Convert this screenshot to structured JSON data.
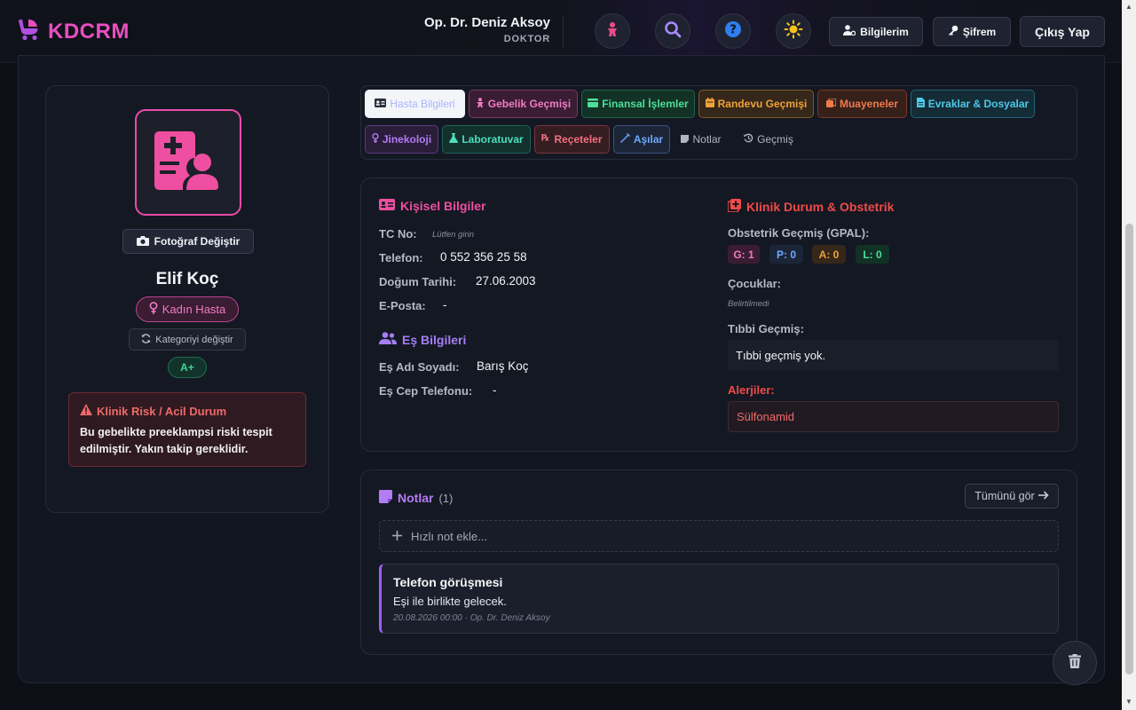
{
  "header": {
    "brand": "KDCRM",
    "user_name": "Op. Dr. Deniz Aksoy",
    "user_role": "DOKTOR",
    "btn_info": "Bilgilerim",
    "btn_password": "Şifrem",
    "btn_logout": "Çıkış Yap"
  },
  "profile": {
    "photo_btn": "Fotoğraf Değiştir",
    "name": "Elif Koç",
    "category": "Kadın Hasta",
    "change_category": "Kategoriyi değiştir",
    "blood_type": "A+",
    "risk_title": "Klinik Risk / Acil Durum",
    "risk_text": "Bu gebelikte preeklampsi riski tespit edilmiştir. Yakın takip gereklidir."
  },
  "tabs": [
    {
      "label": "Hasta Bilgileri",
      "icon": "id-card-icon",
      "color": "#a9b4ff"
    },
    {
      "label": "Gebelik Geçmişi",
      "icon": "baby-icon",
      "color": "#ef7cc2"
    },
    {
      "label": "Finansal İşlemler",
      "icon": "wallet-icon",
      "color": "#4ede9a"
    },
    {
      "label": "Randevu Geçmişi",
      "icon": "calendar-icon",
      "color": "#f0a23a"
    },
    {
      "label": "Muayeneler",
      "icon": "stethoscope-icon",
      "color": "#f07a4a"
    },
    {
      "label": "Evraklar & Dosyalar",
      "icon": "file-icon",
      "color": "#4fc8e8"
    },
    {
      "label": "Jinekoloji",
      "icon": "venus-icon",
      "color": "#b27cf5"
    },
    {
      "label": "Laboratuvar",
      "icon": "flask-icon",
      "color": "#4edec0"
    },
    {
      "label": "Reçeteler",
      "icon": "prescription-icon",
      "color": "#f07080"
    },
    {
      "label": "Aşılar",
      "icon": "syringe-icon",
      "color": "#6fa8ff"
    },
    {
      "label": "Notlar",
      "icon": "note-icon",
      "color": "#b0b4c2"
    },
    {
      "label": "Geçmiş",
      "icon": "history-icon",
      "color": "#b0b4c2"
    }
  ],
  "personal": {
    "title": "Kişisel Bilgiler",
    "tc_label": "TC No:",
    "tc_hint": "Lütfen girin",
    "phone_label": "Telefon:",
    "phone_value": "0 552 356 25 58",
    "dob_label": "Doğum Tarihi:",
    "dob_value": "27.06.2003",
    "email_label": "E-Posta:",
    "email_value": "-"
  },
  "spouse": {
    "title": "Eş Bilgileri",
    "name_label": "Eş Adı Soyadı:",
    "name_value": "Barış Koç",
    "phone_label": "Eş Cep Telefonu:",
    "phone_value": "-"
  },
  "clinical": {
    "title": "Klinik Durum & Obstetrik",
    "gpal_label": "Obstetrik Geçmiş (GPAL):",
    "gpal": {
      "g": "G: 1",
      "p": "P: 0",
      "a": "A: 0",
      "l": "L: 0"
    },
    "children_label": "Çocuklar:",
    "children_hint": "Belirtilmedi",
    "medical_label": "Tıbbi Geçmiş:",
    "medical_value": "Tıbbi geçmiş yok.",
    "allergy_label": "Alerjiler:",
    "allergy_value": "Sülfonamid"
  },
  "notes": {
    "title": "Notlar",
    "count": "(1)",
    "see_all": "Tümünü gör",
    "quick_placeholder": "Hızlı not ekle...",
    "items": [
      {
        "title": "Telefon görüşmesi",
        "body": "Eşi ile birlikte gelecek.",
        "meta": "20.08.2026 00:00 · Op. Dr. Deniz Aksoy"
      }
    ]
  }
}
